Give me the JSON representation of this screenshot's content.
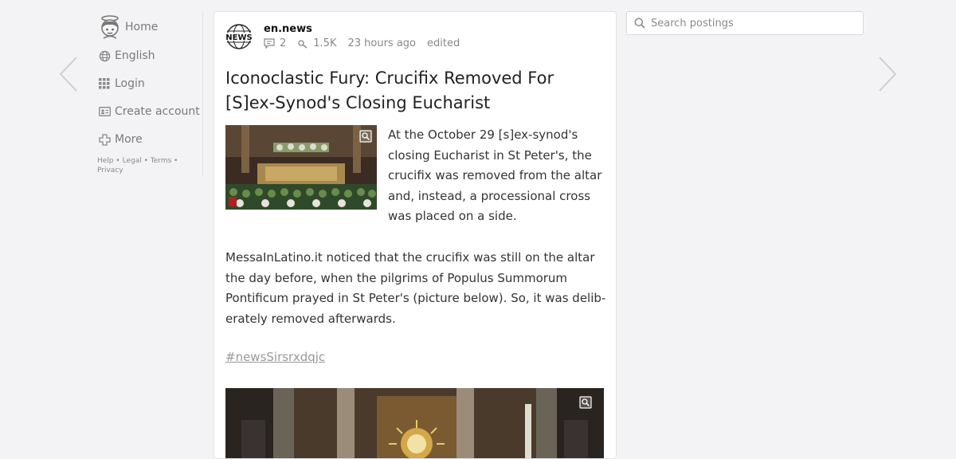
{
  "nav": {
    "home": "Home",
    "language": "English",
    "login": "Login",
    "create_account": "Create account",
    "more": "More",
    "footer": {
      "help": "Help",
      "legal": "Legal",
      "terms": "Terms",
      "privacy": "Privacy",
      "separator": "•"
    }
  },
  "post": {
    "author": "en.news",
    "logo_text": "NEWS",
    "comments": "2",
    "views": "1.5K",
    "time": "23 hours ago",
    "edited": "edited",
    "title": "Iconoclastic Fury: Crucifix Removed For [S]ex-Synod's Closing Eucharist",
    "lead": "At the October 29 [s]ex-synod's closing Eucharist in St Peter's, the crucifix was removed from the altar and, instead, a processional cross was placed on a side.",
    "paragraph": "MessaInLatino.it noticed that the crucifix was still on the altar the day before, when the pilgrims of Populus Summorum Pontificum prayed in St Peter's (picture below). So, it was delib­erately removed afterwards.",
    "hashtag": "#newsSirsrxdqjc"
  },
  "search": {
    "placeholder": "Search postings"
  },
  "icons": {
    "prev": "chevron-left-icon",
    "next": "chevron-right-icon",
    "home": "avatar-icon",
    "language": "globe-icon",
    "login": "grid-icon",
    "create_account": "id-card-icon",
    "more": "plus-icon",
    "comments": "comment-icon",
    "views": "views-icon",
    "zoom": "zoom-icon",
    "search": "search-icon"
  },
  "colors": {
    "background": "#f3f3f5",
    "card": "#ffffff",
    "text": "#222222",
    "muted": "#888888"
  }
}
